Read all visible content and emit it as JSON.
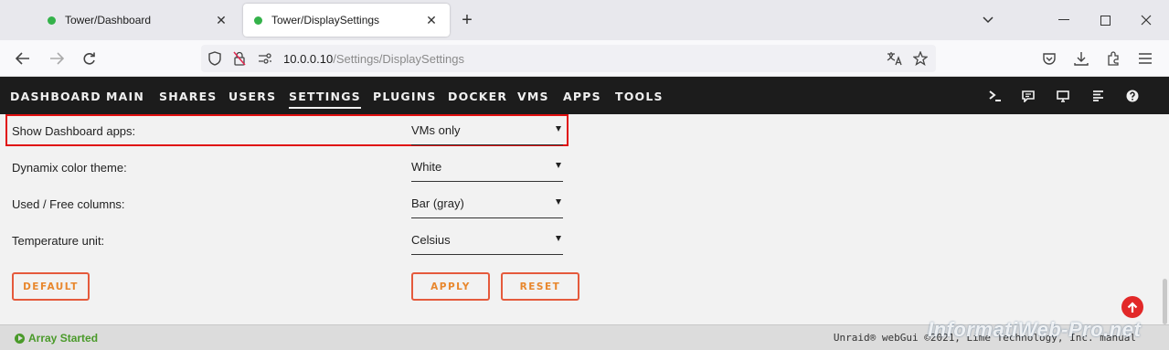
{
  "browser": {
    "tabs": [
      {
        "title": "Tower/Dashboard",
        "active": false
      },
      {
        "title": "Tower/DisplaySettings",
        "active": true
      }
    ],
    "url_host": "10.0.0.10",
    "url_path": "/Settings/DisplaySettings"
  },
  "menu": {
    "items": [
      "DASHBOARD",
      "MAIN",
      "SHARES",
      "USERS",
      "SETTINGS",
      "PLUGINS",
      "DOCKER",
      "VMS",
      "APPS",
      "TOOLS"
    ],
    "active": "SETTINGS"
  },
  "settings": [
    {
      "label": "Show Dashboard apps:",
      "value": "VMs only"
    },
    {
      "label": "Dynamix color theme:",
      "value": "White"
    },
    {
      "label": "Used / Free columns:",
      "value": "Bar (gray)"
    },
    {
      "label": "Temperature unit:",
      "value": "Celsius"
    }
  ],
  "buttons": {
    "default": "DEFAULT",
    "apply": "APPLY",
    "reset": "RESET"
  },
  "footer": {
    "status": "Array Started",
    "copyright": "Unraid® webGui ©2021, Lime Technology, Inc. manual"
  },
  "watermark": "InformatiWeb-Pro.net",
  "colors": {
    "accent": "#e55a3c",
    "status_ok": "#4a9a2a",
    "highlight": "#e01010"
  }
}
